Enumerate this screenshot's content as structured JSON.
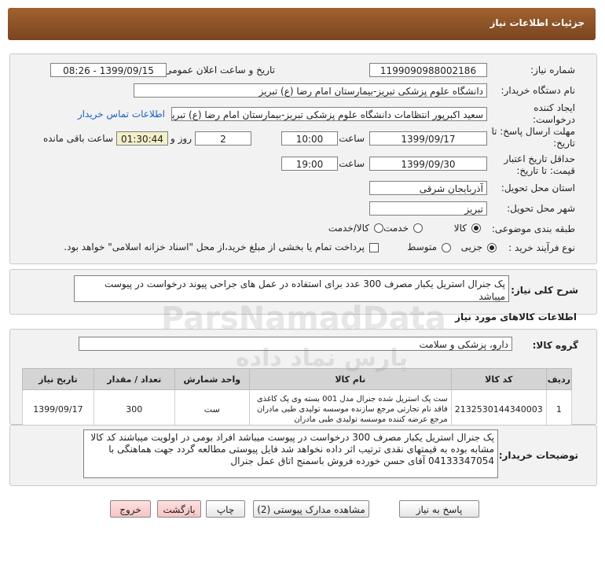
{
  "header": {
    "title": "جزئیات اطلاعات نیاز"
  },
  "fields": {
    "need_number_label": "شماره نیاز:",
    "need_number": "1199090988002186",
    "announce_label": "تاریخ و ساعت اعلان عمومی:",
    "announce_value": "1399/09/15 - 08:26",
    "buyer_org_label": "نام دستگاه خریدار:",
    "buyer_org": "دانشگاه علوم پزشکی تبریز-بیمارستان امام رضا (ع) تبریز",
    "creator_label": "ایجاد کننده درخواست:",
    "creator": "سعید اکبرپور انتظامات دانشگاه علوم پزشکی تبریز-بیمارستان امام رضا (ع) تبریز",
    "contact_link": "اطلاعات تماس خریدار",
    "reply_deadline_label": "مهلت ارسال پاسخ: تا تاریخ:",
    "reply_date": "1399/09/17",
    "time_label": "ساعت",
    "reply_time": "10:00",
    "days_value": "2",
    "days_label": "روز و",
    "remaining_time": "01:30:44",
    "remaining_label": "ساعت باقی مانده",
    "validity_label": "حداقل تاریخ اعتبار قیمت: تا تاریخ:",
    "validity_date": "1399/09/30",
    "validity_time": "19:00",
    "province_label": "استان محل تحویل:",
    "province": "آذربایجان شرقی",
    "city_label": "شهر محل تحویل:",
    "city": "تبریز",
    "category_label": "طبقه بندی موضوعی:",
    "category_options": [
      "کالا",
      "خدمت",
      "کالا/خدمت"
    ],
    "process_label": "نوع فرآیند خرید :",
    "process_options": [
      "جزیی",
      "متوسط"
    ],
    "payment_note": "پرداخت تمام یا بخشی از مبلغ خرید،از محل \"اسناد خزانه اسلامی\" خواهد بود."
  },
  "description": {
    "label": "شرح کلی نیاز:",
    "text": "پک جنرال استریل یکبار مصرف 300 عدد برای استفاده در عمل های جراحی پیوند درخواست در پیوست میباشد"
  },
  "goods": {
    "section_title": "اطلاعات کالاهای مورد نیاز",
    "group_label": "گروه کالا:",
    "group_value": "دارو، پزشکی و سلامت",
    "columns": [
      "ردیف",
      "کد کالا",
      "نام کالا",
      "واحد شمارش",
      "تعداد / مقدار",
      "تاریخ نیاز"
    ],
    "rows": [
      {
        "row": "1",
        "code": "2132530144340003",
        "name": "ست پک استریل شده جنرال مدل 001 بسته وی پک کاغذی فاقد نام تجارتی مرجع سازنده موسسه تولیدی طبی مادران مرجع عرضه کننده موسسه تولیدی طبی مادران",
        "unit": "ست",
        "qty": "300",
        "date": "1399/09/17"
      }
    ]
  },
  "buyer_notes": {
    "label": "توضیحات خریدار:",
    "text": "پک جنرال استریل یکبار مصرف 300 درخواست در پیوست میباشد افراد بومی در اولویت میباشند کد کالا مشابه بوده به قیمتهای نقدی ترتیب اثر داده نخواهد شد فایل پیوستی مطالعه گردد جهت هماهنگی با 04133347054 آقای حسن  خورده فروش باسمنج اتاق عمل جنرال"
  },
  "buttons": {
    "reply": "پاسخ به نیاز",
    "attachments": "مشاهده مدارک پیوستی (2)",
    "print": "چاپ",
    "back": "بازگشت",
    "exit": "خروج"
  },
  "watermark": {
    "text": "ParsNamadData",
    "sub": "پارس نماد داده"
  }
}
